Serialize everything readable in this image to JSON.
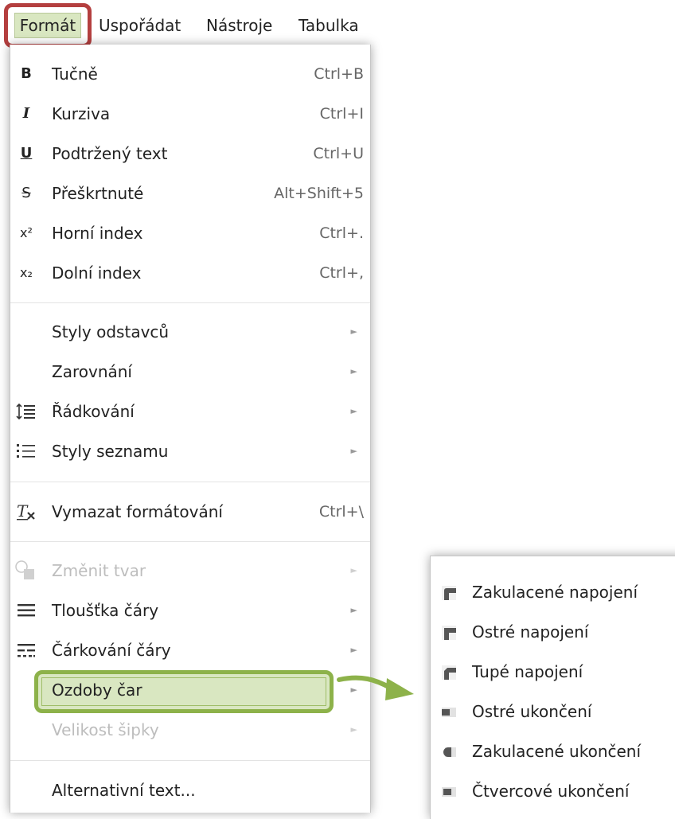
{
  "menubar": {
    "items": [
      "Formát",
      "Uspořádat",
      "Nástroje",
      "Tabulka"
    ]
  },
  "format_menu": {
    "items": [
      {
        "icon": "bold-icon",
        "glyph": "B",
        "label": "Tučně",
        "shortcut": "Ctrl+B"
      },
      {
        "icon": "italic-icon",
        "glyph": "I",
        "label": "Kurziva",
        "shortcut": "Ctrl+I"
      },
      {
        "icon": "underline-icon",
        "glyph": "U",
        "label": "Podtržený text",
        "shortcut": "Ctrl+U"
      },
      {
        "icon": "strikethrough-icon",
        "glyph": "S",
        "label": "Přeškrtnuté",
        "shortcut": "Alt+Shift+5"
      },
      {
        "icon": "superscript-icon",
        "glyph": "x²",
        "label": "Horní index",
        "shortcut": "Ctrl+."
      },
      {
        "icon": "subscript-icon",
        "glyph": "x₂",
        "label": "Dolní index",
        "shortcut": "Ctrl+,"
      },
      {
        "label": "Styly odstavců"
      },
      {
        "label": "Zarovnání"
      },
      {
        "icon": "line-spacing-icon",
        "label": "Řádkování"
      },
      {
        "icon": "list-style-icon",
        "label": "Styly seznamu"
      },
      {
        "icon": "clear-formatting-icon",
        "label": "Vymazat formátování",
        "shortcut": "Ctrl+\\"
      },
      {
        "icon": "change-shape-icon",
        "label": "Změnit tvar"
      },
      {
        "icon": "line-weight-icon",
        "label": "Tloušťka čáry"
      },
      {
        "icon": "line-dash-icon",
        "label": "Čárkování čáry"
      },
      {
        "label": "Ozdoby čar"
      },
      {
        "label": "Velikost šipky"
      },
      {
        "label": "Alternativní text..."
      }
    ]
  },
  "line_decorations_submenu": {
    "items": [
      {
        "icon": "round-join-icon",
        "label": "Zakulacené napojení"
      },
      {
        "icon": "miter-join-icon",
        "label": "Ostré napojení"
      },
      {
        "icon": "bevel-join-icon",
        "label": "Tupé napojení"
      },
      {
        "icon": "butt-cap-icon",
        "label": "Ostré ukončení"
      },
      {
        "icon": "round-cap-icon",
        "label": "Zakulacené ukončení"
      },
      {
        "icon": "square-cap-icon",
        "label": "Čtvercové ukončení"
      }
    ]
  },
  "colors": {
    "highlight_red": "#b43f3f",
    "highlight_green": "#8db24a",
    "highlight_fill": "#d9e7c1"
  }
}
